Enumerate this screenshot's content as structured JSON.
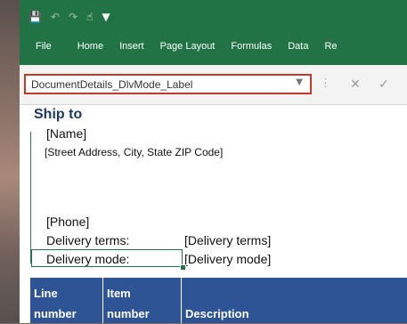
{
  "ribbon": {
    "tabs": [
      "File",
      "Home",
      "Insert",
      "Page Layout",
      "Formulas",
      "Data",
      "Re"
    ]
  },
  "formula_bar": {
    "name_box": "DocumentDetails_DlvMode_Label"
  },
  "sheet": {
    "ship_to": "Ship to",
    "name": "[Name]",
    "address": "[Street Address, City, State ZIP Code]",
    "phone": "[Phone]",
    "delivery_terms_label": "Delivery terms:",
    "delivery_terms_value": "[Delivery terms]",
    "delivery_mode_label": "Delivery mode:",
    "delivery_mode_value": "[Delivery mode]",
    "columns": {
      "line_1": "Line",
      "line_2": "number",
      "item_1": "Item",
      "item_2": "number",
      "description": "Description"
    }
  },
  "colors": {
    "ribbon": "#217346",
    "header": "#2e5496",
    "namebox_highlight": "#c0392b"
  }
}
